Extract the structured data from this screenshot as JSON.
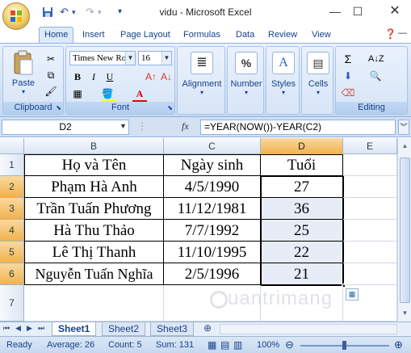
{
  "window": {
    "title": "vidu - Microsoft Excel"
  },
  "qat": {
    "save_icon": "save-icon",
    "undo_icon": "undo-icon",
    "redo_icon": "redo-icon"
  },
  "tabs": [
    "Home",
    "Insert",
    "Page Layout",
    "Formulas",
    "Data",
    "Review",
    "View"
  ],
  "ribbon": {
    "clipboard": {
      "paste_label": "Paste",
      "group_label": "Clipboard"
    },
    "font": {
      "font_name": "Times New Ro",
      "font_size": "16",
      "bold": "B",
      "italic": "I",
      "underline": "U",
      "font_color_glyph": "A",
      "group_label": "Font"
    },
    "alignment": {
      "label": "Alignment"
    },
    "number": {
      "label": "Number",
      "glyph": "%"
    },
    "styles": {
      "label": "Styles",
      "glyph": "A"
    },
    "cells": {
      "label": "Cells"
    },
    "editing": {
      "group_label": "Editing"
    }
  },
  "formula_bar": {
    "name_box": "D2",
    "fx": "fx",
    "formula": "=YEAR(NOW())-YEAR(C2)"
  },
  "columns": [
    "B",
    "C",
    "D",
    "E"
  ],
  "rows": [
    "1",
    "2",
    "3",
    "4",
    "5",
    "6",
    "7"
  ],
  "table": {
    "headers": [
      "Họ và Tên",
      "Ngày sinh",
      "Tuổi"
    ],
    "data": [
      [
        "Phạm Hà Anh",
        "4/5/1990",
        "27"
      ],
      [
        "Trần Tuấn Phương",
        "11/12/1981",
        "36"
      ],
      [
        "Hà Thu Thảo",
        "7/7/1992",
        "25"
      ],
      [
        "Lê Thị Thanh",
        "11/10/1995",
        "22"
      ],
      [
        "Nguyễn Tuấn Nghĩa",
        "2/5/1996",
        "21"
      ]
    ]
  },
  "sheets": [
    "Sheet1",
    "Sheet2",
    "Sheet3"
  ],
  "status": {
    "ready": "Ready",
    "average": "Average: 26",
    "count": "Count: 5",
    "sum": "Sum: 131",
    "zoom": "100%"
  },
  "watermark": "uantrimang"
}
